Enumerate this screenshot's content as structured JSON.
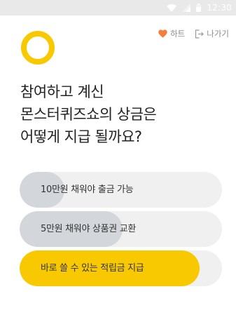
{
  "status_bar": {
    "time": "12:30",
    "icons": [
      "wifi-icon",
      "signal-icon",
      "battery-icon"
    ]
  },
  "header": {
    "logo": "ring-logo",
    "actions": [
      {
        "label": "하트",
        "icon": "heart-icon"
      },
      {
        "label": "나가기",
        "icon": "exit-icon"
      }
    ]
  },
  "question": {
    "lines": [
      "참여하고 계신",
      "몬스터퀴즈쇼의 상금은",
      "어떻게 지급 될까요?"
    ]
  },
  "options": [
    {
      "label": "10만원 채워야 출금 가능",
      "fill_percent": 22,
      "fill_color": "#d3d7db"
    },
    {
      "label": "5만원 채워야 상품권 교환",
      "fill_percent": 51,
      "fill_color": "#d3d7db"
    },
    {
      "label": "바로 쓸 수 있는 적립금 지급",
      "fill_percent": 89,
      "fill_color": "#f8c900"
    }
  ],
  "colors": {
    "accent": "#f8c900",
    "heart": "#f47f3c",
    "option_track": "#f0f0f0",
    "option_fill": "#d3d7db"
  }
}
